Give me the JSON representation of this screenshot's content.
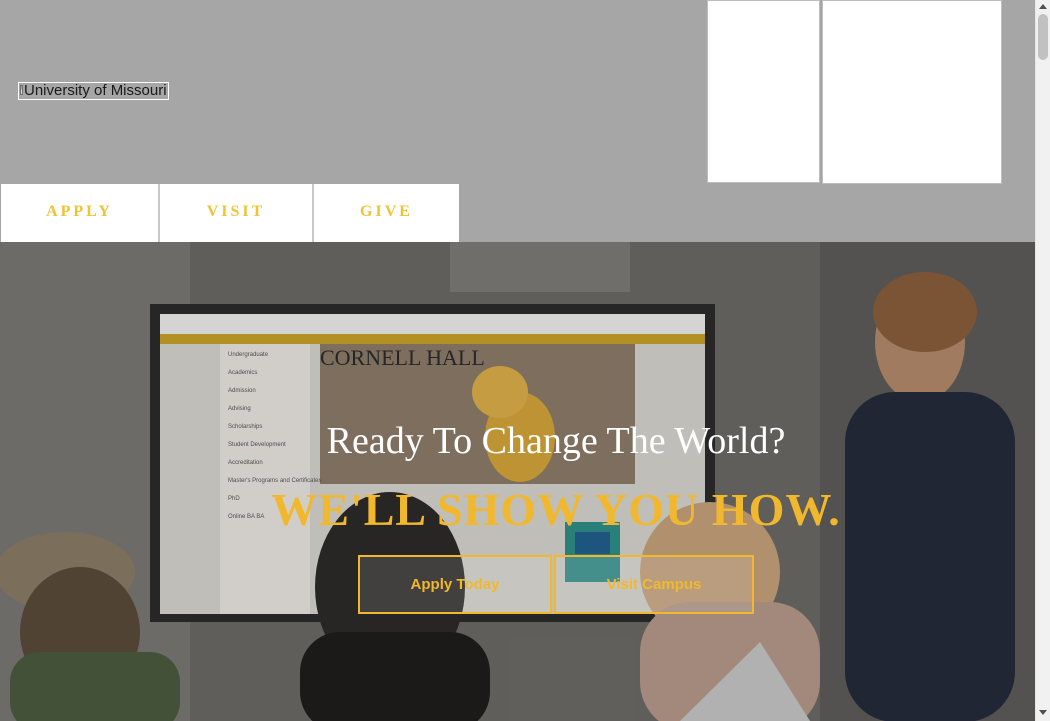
{
  "header": {
    "logo_alt": "University of Missouri",
    "nav": [
      {
        "label": "APPLY"
      },
      {
        "label": "VISIT"
      },
      {
        "label": "GIVE"
      }
    ]
  },
  "hero": {
    "title": "Ready To Change The World?",
    "subtitle": "WE'LL SHOW YOU HOW.",
    "buttons": [
      {
        "label": "Apply Today"
      },
      {
        "label": "Visit Campus"
      }
    ],
    "screen_heading": "CORNELL HALL",
    "screen_menu": [
      "Undergraduate",
      "Academics",
      "Admission",
      "Advising",
      "Scholarships",
      "Student Development",
      "Accreditation",
      "Master's Programs and Certificates",
      "PhD",
      "Online BA BA"
    ]
  },
  "colors": {
    "gold": "#f1b82d",
    "header_bg": "#a6a6a6",
    "nav_text": "#f2c230"
  }
}
